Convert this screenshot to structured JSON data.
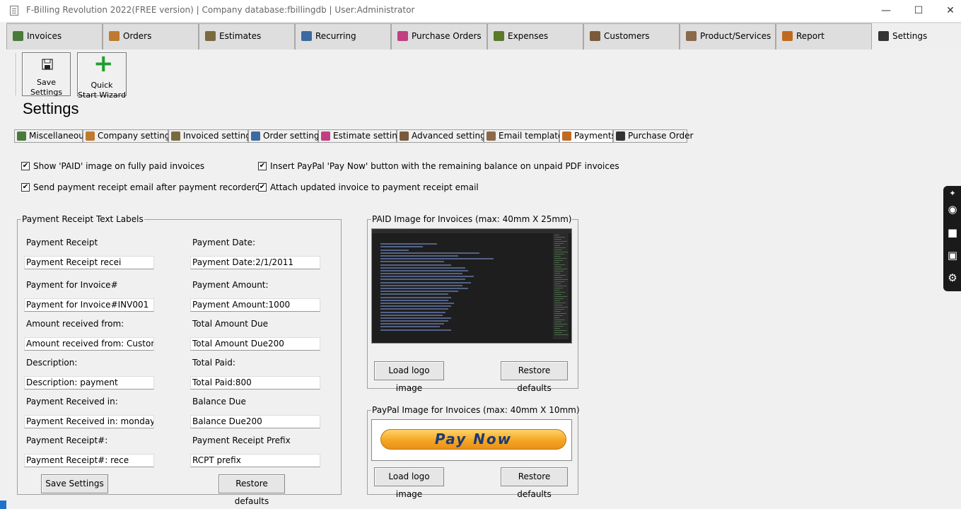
{
  "window": {
    "title": "F-Billing Revolution 2022(FREE version) | Company database:fbillingdb | User:Administrator",
    "minimize": "—",
    "maximize": "☐",
    "close": "✕"
  },
  "main_tabs": [
    {
      "label": "Invoices",
      "icon": "invoices-icon",
      "color": "#4a7a3a"
    },
    {
      "label": "Orders",
      "icon": "orders-icon",
      "color": "#c07a30"
    },
    {
      "label": "Estimates",
      "icon": "estimates-icon",
      "color": "#7a6a40"
    },
    {
      "label": "Recurring",
      "icon": "recurring-icon",
      "color": "#3a6aa0"
    },
    {
      "label": "Purchase Orders",
      "icon": "purchase-orders-icon",
      "color": "#c04080"
    },
    {
      "label": "Expenses",
      "icon": "expenses-icon",
      "color": "#5a7a2a"
    },
    {
      "label": "Customers",
      "icon": "customers-icon",
      "color": "#7a5a3a"
    },
    {
      "label": "Product/Services",
      "icon": "products-icon",
      "color": "#8a6a4a"
    },
    {
      "label": "Report",
      "icon": "report-icon",
      "color": "#c06a20"
    },
    {
      "label": "Settings",
      "icon": "gear-icon",
      "color": "#333333"
    }
  ],
  "toolbar": {
    "save_label_1": "Save",
    "save_label_2": "Settings",
    "wizard_label_1": "Quick",
    "wizard_label_2": "Start Wizard",
    "wizard_icon": "+"
  },
  "page_title": "Settings",
  "sub_tabs": [
    {
      "label": "Miscellaneous",
      "icon": "misc-icon",
      "color": "#4a7a3a"
    },
    {
      "label": "Company settings",
      "icon": "company-icon",
      "color": "#c07a30"
    },
    {
      "label": "Invoiced settings",
      "icon": "invoiced-icon",
      "color": "#7a6a40"
    },
    {
      "label": "Order settings",
      "icon": "order-icon",
      "color": "#3a6aa0"
    },
    {
      "label": "Estimate settings",
      "icon": "estimate-icon",
      "color": "#c04080"
    },
    {
      "label": "Advanced settings",
      "icon": "advanced-icon",
      "color": "#7a5a3a"
    },
    {
      "label": "Email templates",
      "icon": "email-icon",
      "color": "#8a6a4a"
    },
    {
      "label": "Payments",
      "icon": "payments-icon",
      "color": "#c06a20"
    },
    {
      "label": "Purchase Order",
      "icon": "gear-icon",
      "color": "#333333"
    }
  ],
  "options": {
    "show_paid": "Show 'PAID' image on fully paid invoices",
    "send_receipt": "Send payment receipt email after payment recorderd",
    "insert_paypal": "Insert PayPal 'Pay Now' button with the remaining balance on unpaid PDF invoices",
    "attach_invoice": "Attach updated invoice to payment receipt email",
    "checked_mark": "✔"
  },
  "labels_group": {
    "title": "Payment Receipt Text Labels",
    "fields": [
      {
        "label": "Payment Receipt",
        "value": "Payment Receipt recei"
      },
      {
        "label": "Payment Date:",
        "value": "Payment Date:2/1/2011"
      },
      {
        "label": "Payment for Invoice#",
        "value": "Payment for Invoice#INV001"
      },
      {
        "label": "Payment Amount:",
        "value": "Payment Amount:1000"
      },
      {
        "label": "Amount received from:",
        "value": "Amount received from: Customer"
      },
      {
        "label": "Total Amount Due",
        "value": "Total Amount Due200"
      },
      {
        "label": "Description:",
        "value": "Description: payment"
      },
      {
        "label": "Total Paid:",
        "value": "Total Paid:800"
      },
      {
        "label": "Payment Received in:",
        "value": "Payment Received in: monday"
      },
      {
        "label": "Balance Due",
        "value": "Balance Due200"
      },
      {
        "label": "Payment Receipt#:",
        "value": "Payment  Receipt#:   rece"
      },
      {
        "label": "Payment Receipt Prefix",
        "value": "RCPT  prefix"
      }
    ],
    "save_button": "Save Settings",
    "restore_button": "Restore defaults"
  },
  "paid_image_group": {
    "title": "PAID Image for Invoices (max: 40mm X 25mm)",
    "load_button": "Load logo image",
    "restore_button": "Restore defaults"
  },
  "paypal_image_group": {
    "title": "PayPal Image for Invoices (max: 40mm X 10mm)",
    "paypal_text": "Pay Now",
    "load_button": "Load logo image",
    "restore_button": "Restore defaults"
  },
  "side_panel": {
    "icons": [
      "pin-icon",
      "camera-icon",
      "video-icon",
      "gallery-icon",
      "settings-gear-icon"
    ]
  }
}
